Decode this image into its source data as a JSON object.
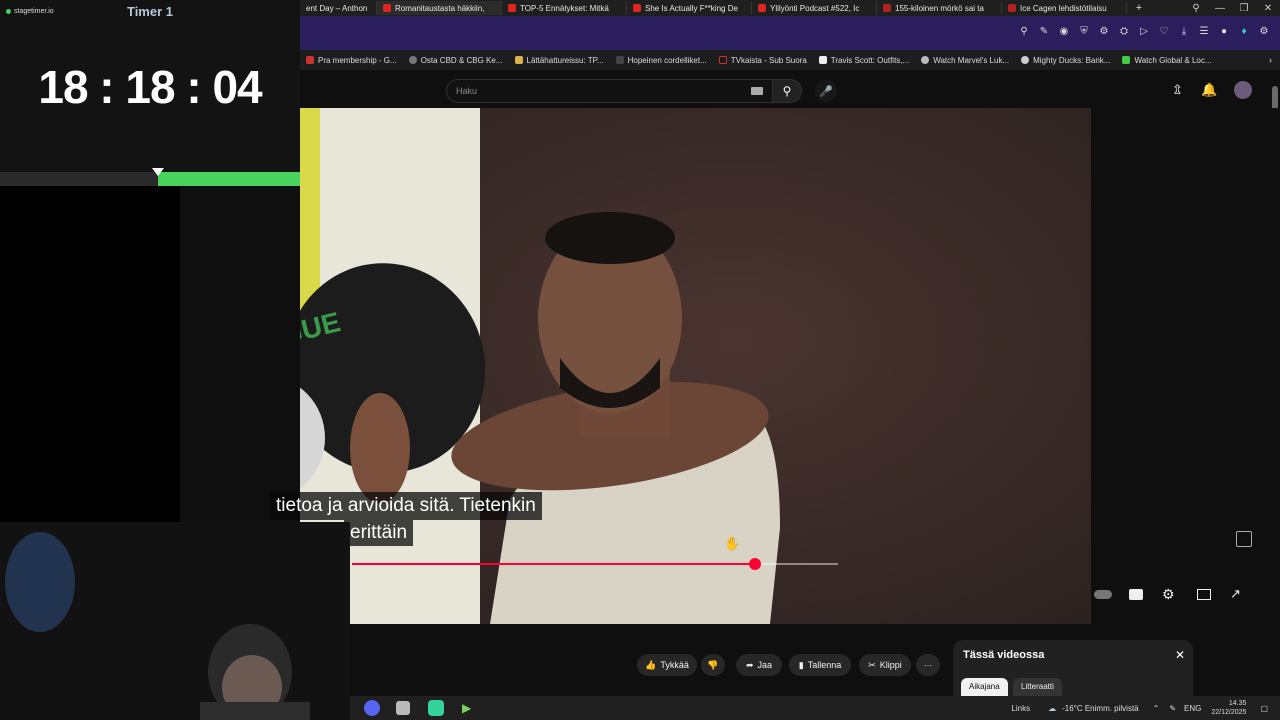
{
  "timer": {
    "app_name": "stagetimer.io",
    "title": "Timer 1",
    "time": "18 : 18 : 04"
  },
  "browser": {
    "tabs": [
      {
        "label": "ent Day – Anthon"
      },
      {
        "label": "Romanitaustasta häkkiin,"
      },
      {
        "label": "TOP-5 Ennätykset: Mitkä"
      },
      {
        "label": "She Is Actually F**king De"
      },
      {
        "label": "Ylilyönti Podcast #522, Ic"
      },
      {
        "label": "155-kiloinen mörkö sai ta"
      },
      {
        "label": "Ice Cagen lehdistötilaisu"
      }
    ],
    "new_tab": "+",
    "bookmarks": [
      {
        "label": "Pra membership - G..."
      },
      {
        "label": "Osta CBD & CBG Ke..."
      },
      {
        "label": "Lättähattureissu: TP..."
      },
      {
        "label": "Hopeinen cordelliket..."
      },
      {
        "label": "TVkaista - Sub Suora"
      },
      {
        "label": "Travis Scott: Outfits,..."
      },
      {
        "label": "Watch Marvel's Luk..."
      },
      {
        "label": "Mighty Ducks: Bank..."
      },
      {
        "label": "Watch Global & Loc..."
      }
    ]
  },
  "youtube": {
    "search_placeholder": "Haku",
    "video": {
      "plate_text": "ROGUE",
      "subtitle_line1": "tietoa ja arvioida sitä.  Tietenkin",
      "subtitle_line2": "erittäin",
      "progress": 0.83
    },
    "actions": [
      {
        "label": "Tykkää"
      },
      {
        "label": ""
      },
      {
        "label": "Jaa"
      },
      {
        "label": "Tallenna"
      },
      {
        "label": "Klippi"
      },
      {
        "label": "···"
      }
    ],
    "in_video_panel": {
      "title": "Tässä videossa",
      "tabs": [
        "Aikajana",
        "Litteraatti"
      ]
    }
  },
  "taskbar": {
    "links": "Links",
    "weather": "-16°C  Enimm. pilvistä",
    "lang": "ENG",
    "time": "14.35",
    "date": "22/12/2025"
  }
}
